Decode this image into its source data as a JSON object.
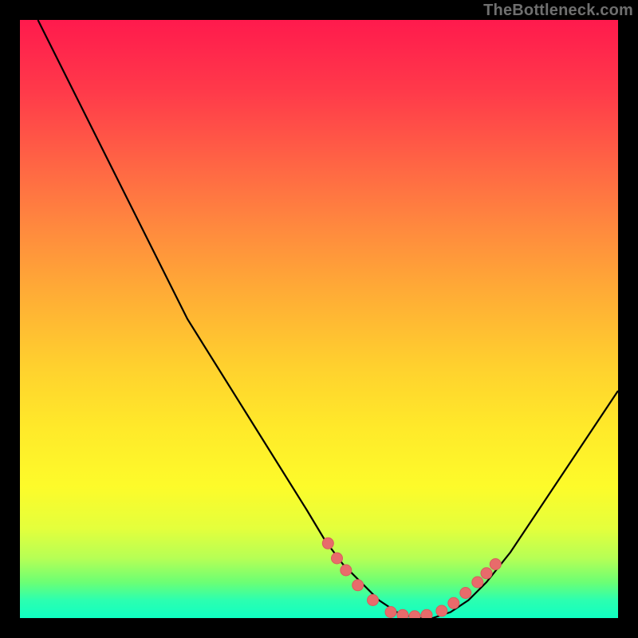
{
  "watermark": "TheBottleneck.com",
  "colors": {
    "background": "#000000",
    "curve": "#000000",
    "marker_fill": "#e86b6b",
    "marker_stroke": "#d95c5c"
  },
  "chart_data": {
    "type": "line",
    "title": "",
    "xlabel": "",
    "ylabel": "",
    "xlim": [
      0,
      100
    ],
    "ylim": [
      0,
      100
    ],
    "series": [
      {
        "name": "bottleneck-curve",
        "x": [
          3,
          8,
          13,
          18,
          23,
          28,
          33,
          38,
          43,
          48,
          51,
          54,
          57,
          60,
          63,
          66,
          69,
          72,
          75,
          78,
          82,
          86,
          90,
          94,
          98,
          100
        ],
        "y": [
          100,
          90,
          80,
          70,
          60,
          50,
          42,
          34,
          26,
          18,
          13,
          9,
          6,
          3,
          1,
          0,
          0,
          1,
          3,
          6,
          11,
          17,
          23,
          29,
          35,
          38
        ]
      }
    ],
    "markers": {
      "name": "highlight-dots",
      "x_range_hint": "cluster near curve minimum",
      "x": [
        51.5,
        53.0,
        54.5,
        56.5,
        59.0,
        62.0,
        64.0,
        66.0,
        68.0,
        70.5,
        72.5,
        74.5,
        76.5,
        78.0,
        79.5
      ],
      "y": [
        12.5,
        10.0,
        8.0,
        5.5,
        3.0,
        1.0,
        0.5,
        0.3,
        0.5,
        1.2,
        2.5,
        4.2,
        6.0,
        7.5,
        9.0
      ]
    }
  }
}
